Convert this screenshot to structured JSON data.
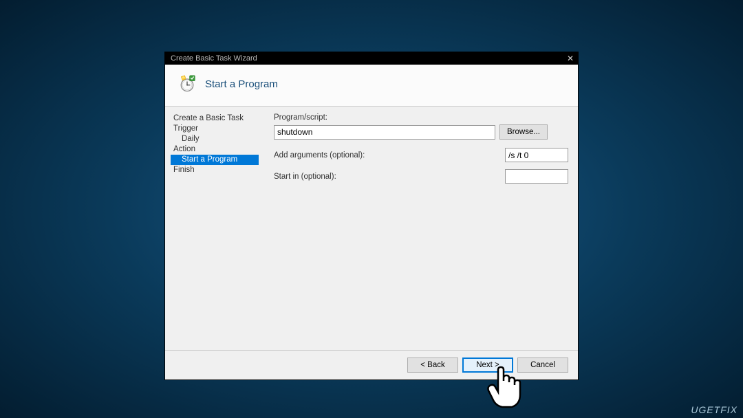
{
  "window": {
    "title": "Create Basic Task Wizard",
    "close_label": "✕"
  },
  "header": {
    "title": "Start a Program"
  },
  "sidebar": {
    "items": [
      {
        "label": "Create a Basic Task",
        "indent": 0,
        "selected": false
      },
      {
        "label": "Trigger",
        "indent": 0,
        "selected": false
      },
      {
        "label": "Daily",
        "indent": 1,
        "selected": false
      },
      {
        "label": "Action",
        "indent": 0,
        "selected": false
      },
      {
        "label": "Start a Program",
        "indent": 1,
        "selected": true
      },
      {
        "label": "Finish",
        "indent": 0,
        "selected": false
      }
    ]
  },
  "content": {
    "program_label": "Program/script:",
    "program_value": "shutdown",
    "browse_label": "Browse...",
    "arguments_label": "Add arguments (optional):",
    "arguments_value": "/s /t 0",
    "startin_label": "Start in (optional):",
    "startin_value": ""
  },
  "footer": {
    "back_label": "< Back",
    "next_label": "Next >",
    "cancel_label": "Cancel"
  },
  "watermark": "UGETFIX"
}
